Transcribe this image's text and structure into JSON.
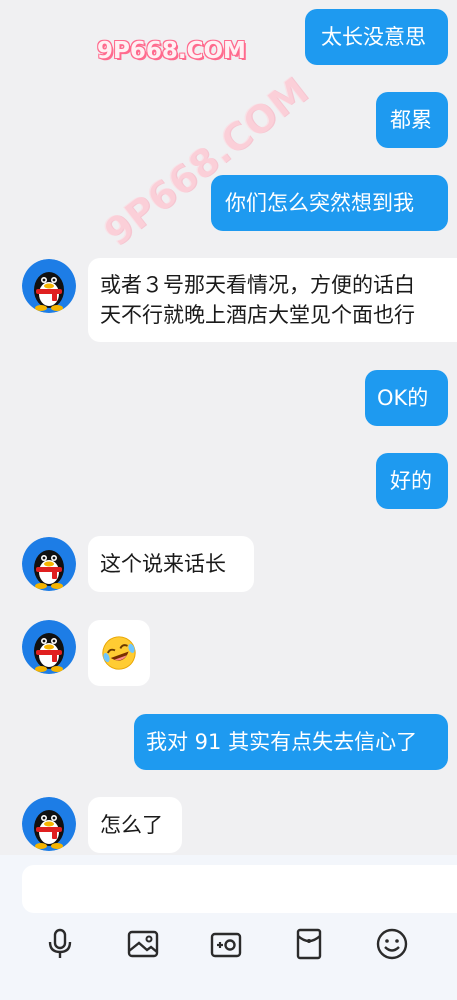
{
  "watermark": {
    "top": "9P668.COM",
    "diagonal": "9P668.COM"
  },
  "messages": [
    {
      "id": "m1",
      "side": "me",
      "text": "太长没意思"
    },
    {
      "id": "m2",
      "side": "me",
      "text": "都累"
    },
    {
      "id": "m3",
      "side": "me",
      "text": "你们怎么突然想到我"
    },
    {
      "id": "m4",
      "side": "them",
      "lines": [
        "或者３号那天看情况，方便的话白",
        "天不行就晚上酒店大堂见个面也行"
      ]
    },
    {
      "id": "m5",
      "side": "me",
      "text": "OK的"
    },
    {
      "id": "m6",
      "side": "me",
      "text": "好的"
    },
    {
      "id": "m7",
      "side": "them",
      "text": "这个说来话长"
    },
    {
      "id": "m8",
      "side": "them",
      "emoji": "laughing-crying-emoji"
    },
    {
      "id": "m9",
      "side": "me",
      "text": "我对 91 其实有点失去信心了"
    },
    {
      "id": "m10",
      "side": "them",
      "text": "怎么了"
    }
  ],
  "input": {
    "placeholder": "",
    "value": ""
  },
  "toolbar": {
    "items": [
      "microphone-icon",
      "image-icon",
      "camera-icon",
      "red-envelope-icon",
      "emoji-icon"
    ]
  },
  "colors": {
    "background": "#f0f0f2",
    "outgoing_bubble": "#1e9af0",
    "incoming_bubble": "#ffffff",
    "icon": "#2b2b2b"
  }
}
